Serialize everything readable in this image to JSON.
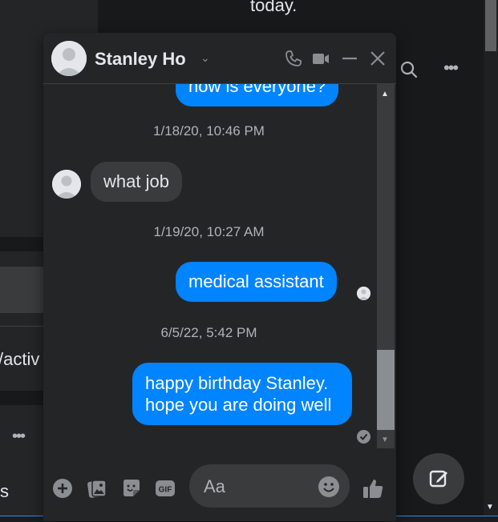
{
  "background": {
    "top_text": "today.",
    "left_text": "/activ",
    "left_s": "s",
    "more_label": "•••"
  },
  "chat": {
    "contact_name": "Stanley Ho",
    "chevron": "⌄",
    "messages": {
      "partial_out": "how is everyone?",
      "ts1": "1/18/20, 10:46 PM",
      "in1": "what job",
      "ts2": "1/19/20, 10:27 AM",
      "out1": "medical assistant",
      "ts3": "6/5/22, 5:42 PM",
      "out2": "happy birthday Stanley. hope you are doing well"
    },
    "composer": {
      "placeholder": "Aa"
    }
  },
  "colors": {
    "accent": "#0084ff",
    "panel": "#242526",
    "bubble_in": "#3a3b3c"
  }
}
